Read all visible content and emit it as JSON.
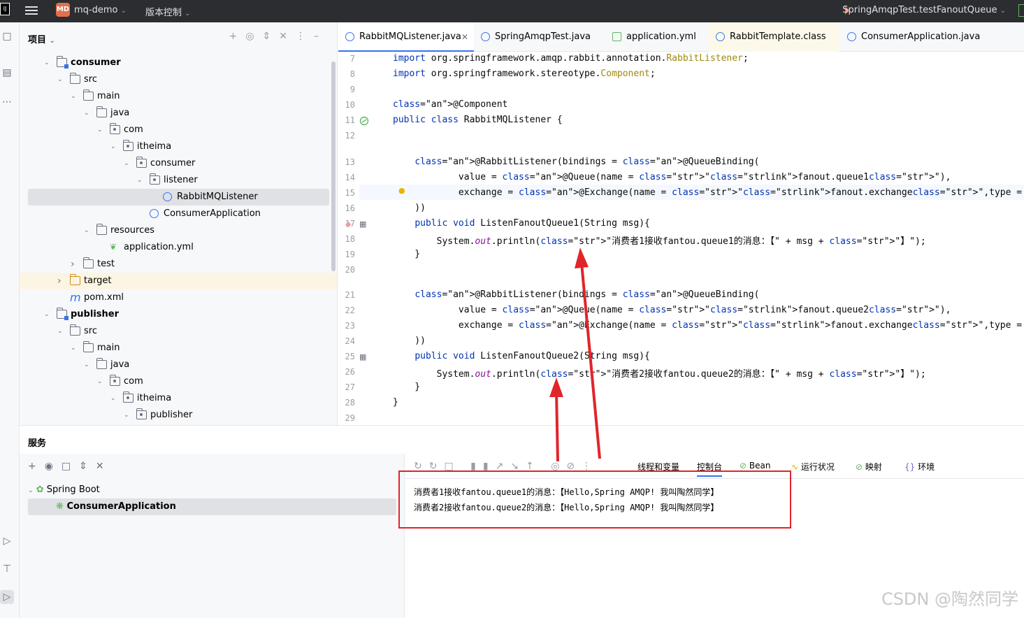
{
  "titlebar": {
    "project_badge": "MD",
    "project_name": "mq-demo",
    "vcs_label": "版本控制",
    "run_config": "SpringAmqpTest.testFanoutQueue"
  },
  "project_panel": {
    "title": "项目",
    "tree": [
      {
        "label": "consumer",
        "bold": true
      },
      {
        "label": "src"
      },
      {
        "label": "main"
      },
      {
        "label": "java"
      },
      {
        "label": "com"
      },
      {
        "label": "itheima"
      },
      {
        "label": "consumer"
      },
      {
        "label": "listener"
      },
      {
        "label": "RabbitMQListener"
      },
      {
        "label": "ConsumerApplication"
      },
      {
        "label": "resources"
      },
      {
        "label": "application.yml"
      },
      {
        "label": "test"
      },
      {
        "label": "target"
      },
      {
        "label": "pom.xml"
      },
      {
        "label": "publisher",
        "bold": true
      },
      {
        "label": "src"
      },
      {
        "label": "main"
      },
      {
        "label": "java"
      },
      {
        "label": "com"
      },
      {
        "label": "itheima"
      },
      {
        "label": "publisher"
      }
    ]
  },
  "tabs": [
    {
      "label": "RabbitMQListener.java",
      "active": true
    },
    {
      "label": "SpringAmqpTest.java"
    },
    {
      "label": "application.yml"
    },
    {
      "label": "RabbitTemplate.class"
    },
    {
      "label": "ConsumerApplication.java"
    }
  ],
  "editor": {
    "lines": [
      {
        "n": "7",
        "code": "import org.springframework.amqp.rabbit.annotation.RabbitListener;"
      },
      {
        "n": "8",
        "code": "import org.springframework.stereotype.Component;"
      },
      {
        "n": "9",
        "code": ""
      },
      {
        "n": "10",
        "code": "@Component"
      },
      {
        "n": "11",
        "code": "public class RabbitMQListener {"
      },
      {
        "n": "12",
        "code": ""
      },
      {
        "n": "13",
        "code": "    @RabbitListener(bindings = @QueueBinding("
      },
      {
        "n": "14",
        "code": "            value = @Queue(name = \"fanout.queue1\"),"
      },
      {
        "n": "15",
        "code": "            exchange = @Exchange(name = \"fanout.exchange\",type = ExchangeTypes.FANOUT)"
      },
      {
        "n": "16",
        "code": "    ))"
      },
      {
        "n": "17",
        "code": "    public void ListenFanoutQueue1(String msg){"
      },
      {
        "n": "18",
        "code": "        System.out.println(\"消费者1接收fantou.queue1的消息：【\" + msg + \"】\");"
      },
      {
        "n": "19",
        "code": "    }"
      },
      {
        "n": "20",
        "code": ""
      },
      {
        "n": "21",
        "code": "    @RabbitListener(bindings = @QueueBinding("
      },
      {
        "n": "22",
        "code": "            value = @Queue(name = \"fanout.queue2\"),"
      },
      {
        "n": "23",
        "code": "            exchange = @Exchange(name = \"fanout.exchange\",type = ExchangeTypes.FANOUT)"
      },
      {
        "n": "24",
        "code": "    ))"
      },
      {
        "n": "25",
        "code": "    public void ListenFanoutQueue2(String msg){"
      },
      {
        "n": "26",
        "code": "        System.out.println(\"消费者2接收fantou.queue2的消息：【\" + msg + \"】\");"
      },
      {
        "n": "27",
        "code": "    }"
      },
      {
        "n": "28",
        "code": "}"
      },
      {
        "n": "29",
        "code": ""
      }
    ]
  },
  "services": {
    "title": "服务",
    "tree": [
      {
        "label": "Spring Boot"
      },
      {
        "label": "ConsumerApplication",
        "selected": true
      }
    ],
    "console_tabs": [
      "线程和变量",
      "控制台",
      "Bean",
      "运行状况",
      "映射",
      "环境"
    ],
    "output": [
      "消费者1接收fantou.queue1的消息：【Hello,Spring AMQP! 我叫陶然同学】",
      "消费者2接收fantou.queue2的消息：【Hello,Spring AMQP! 我叫陶然同学】"
    ]
  },
  "watermark": "CSDN @陶然同学",
  "colors": {
    "accent": "#3574f0",
    "annotation_red": "#e0252b",
    "keyword": "#0033b3",
    "annotation": "#9e880d",
    "string": "#067d17"
  }
}
